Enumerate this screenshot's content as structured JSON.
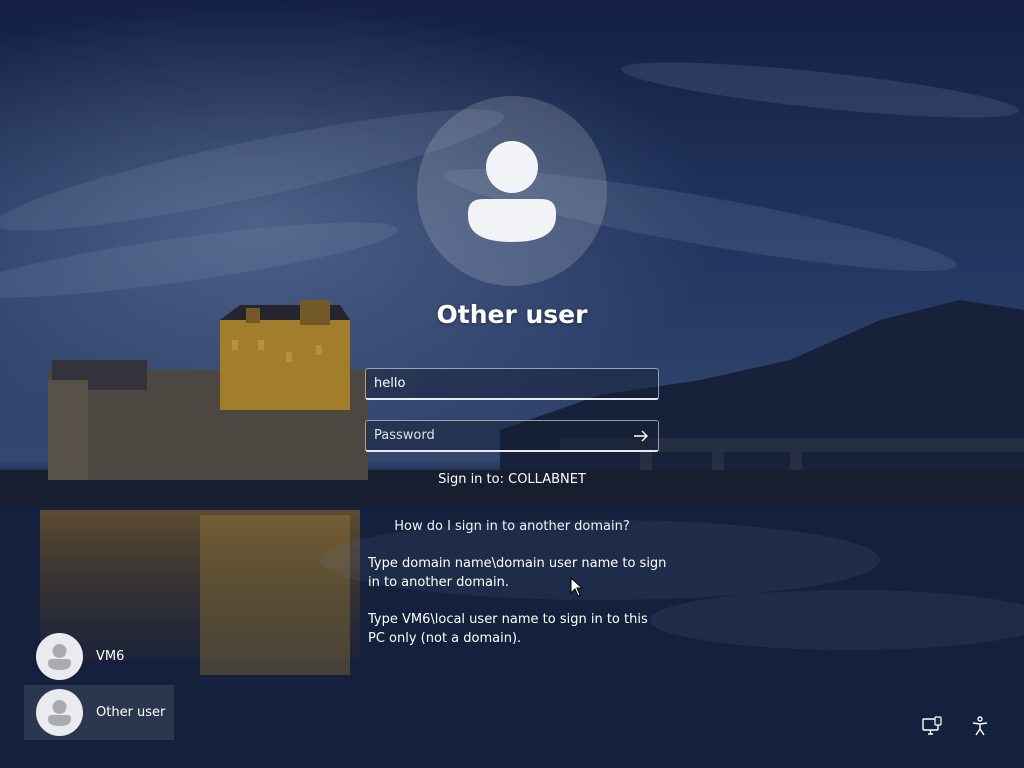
{
  "login": {
    "user_title": "Other user",
    "username_value": "hello",
    "password_placeholder": "Password",
    "sign_in_to": "Sign in to: COLLABNET",
    "help_link": "How do I sign in to another domain?",
    "help_text_1": "Type domain name\\domain user name to sign in to another domain.",
    "help_text_2": "Type VM6\\local user name to sign in to this PC only (not a domain)."
  },
  "users": [
    {
      "label": "VM6",
      "selected": false
    },
    {
      "label": "Other user",
      "selected": true
    }
  ],
  "icons": {
    "large_avatar": "person-icon",
    "submit": "arrow-right-icon",
    "network": "network-icon",
    "accessibility": "accessibility-icon"
  },
  "colors": {
    "sky": "#1b2c55",
    "castle_light": "#c79a3a",
    "water": "#172544"
  }
}
